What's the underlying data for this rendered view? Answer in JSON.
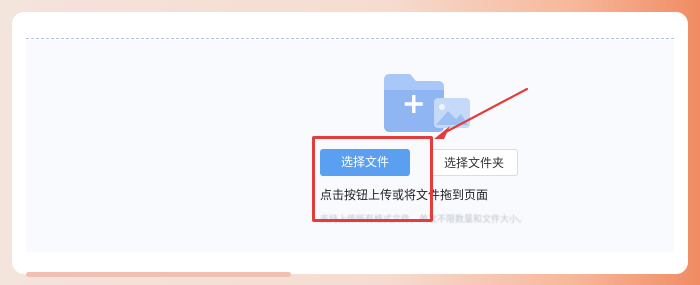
{
  "upload": {
    "select_file_label": "选择文件",
    "select_folder_label": "选择文件夹",
    "hint": "点击按钮上传或将文件拖到页面",
    "subhint": "支持上传所有格式文件，单次不限数量和文件大小。"
  },
  "icons": {
    "folder": "folder-add-icon",
    "image": "image-icon",
    "arrow": "annotation-arrow"
  },
  "colors": {
    "primary_button": "#5b9ff0",
    "annotation": "#e53b3b",
    "folder": "#a9c8f7"
  }
}
